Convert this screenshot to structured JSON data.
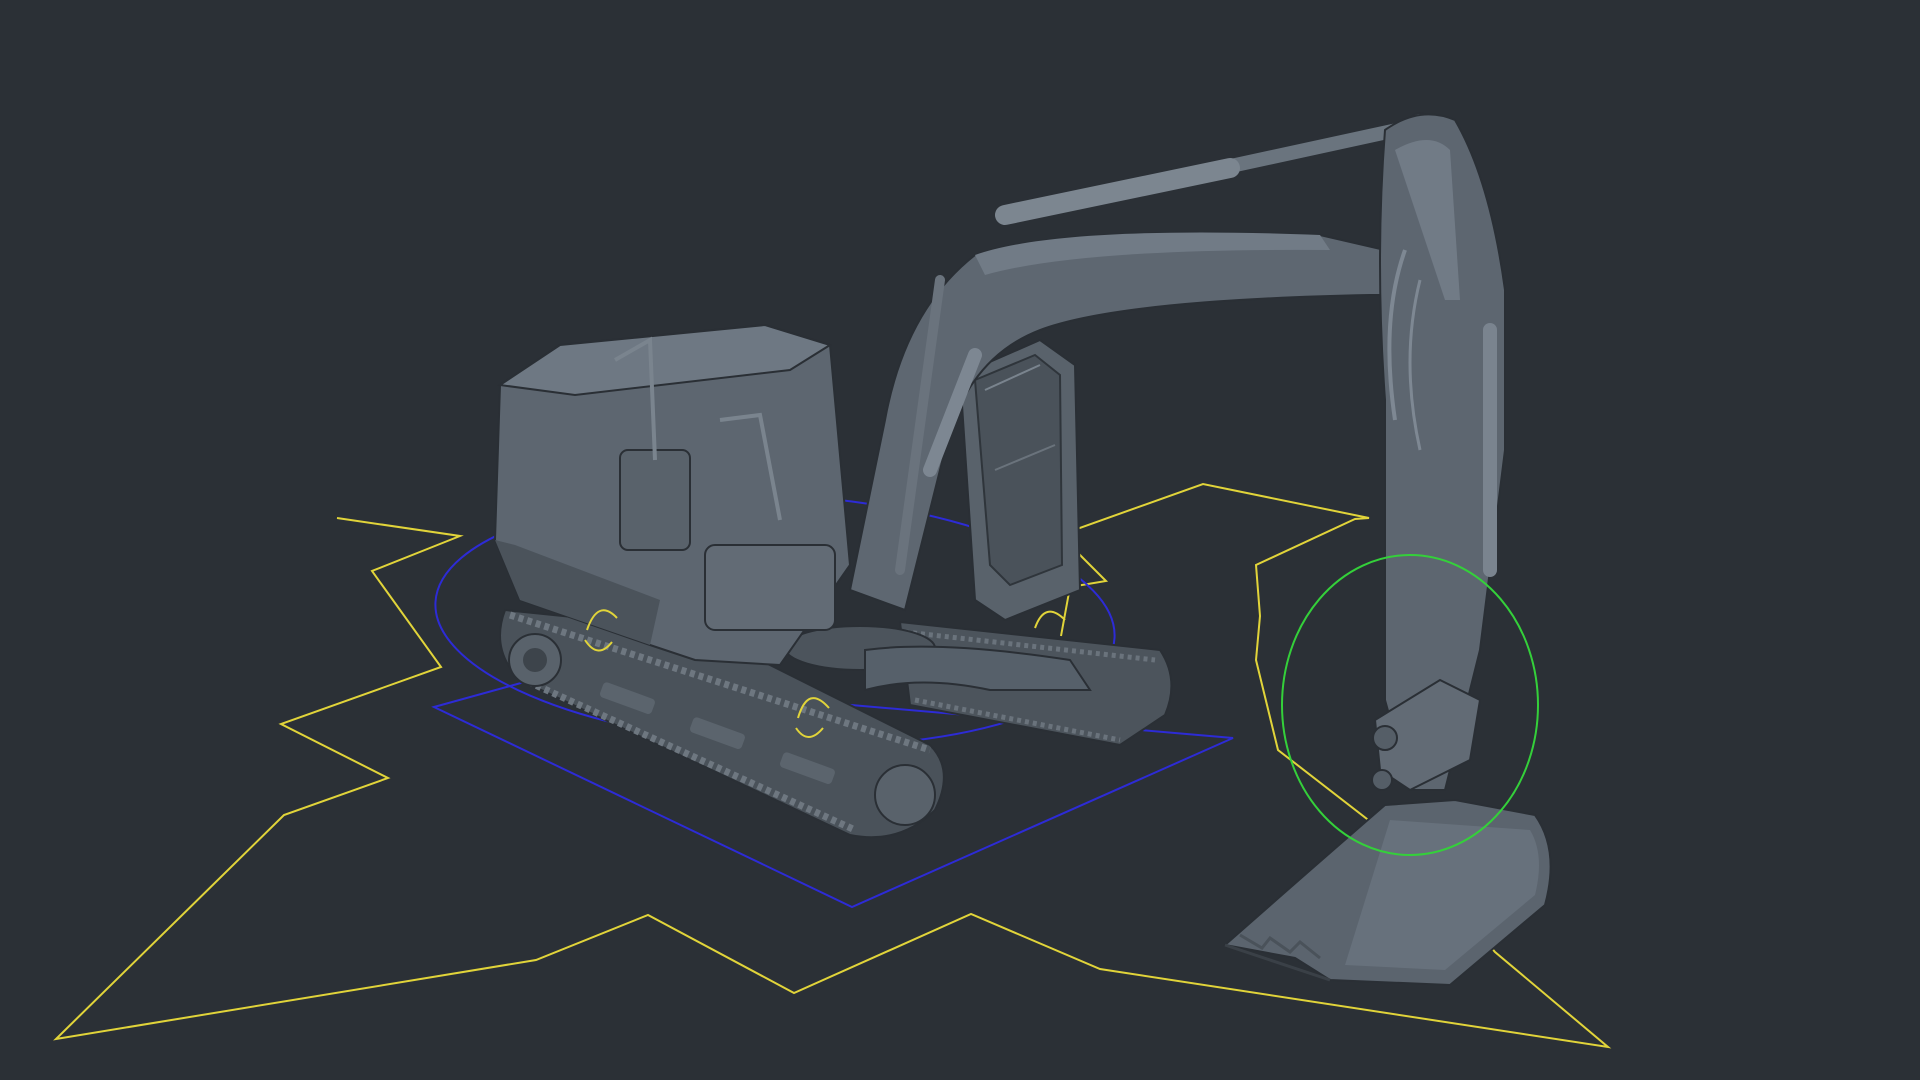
{
  "viewport": {
    "background": "#2b3036",
    "model": "excavator",
    "model_color": "#5d6670",
    "model_shadow": "#3f464e",
    "model_highlight": "#78828d",
    "controls": {
      "root_star_color": "#e1d43a",
      "base_ring_color": "#2d2bd6",
      "base_square_color": "#2d2bd6",
      "arm_ring_color": "#34d03a",
      "wheel_handle_color": "#e1d43a"
    }
  }
}
